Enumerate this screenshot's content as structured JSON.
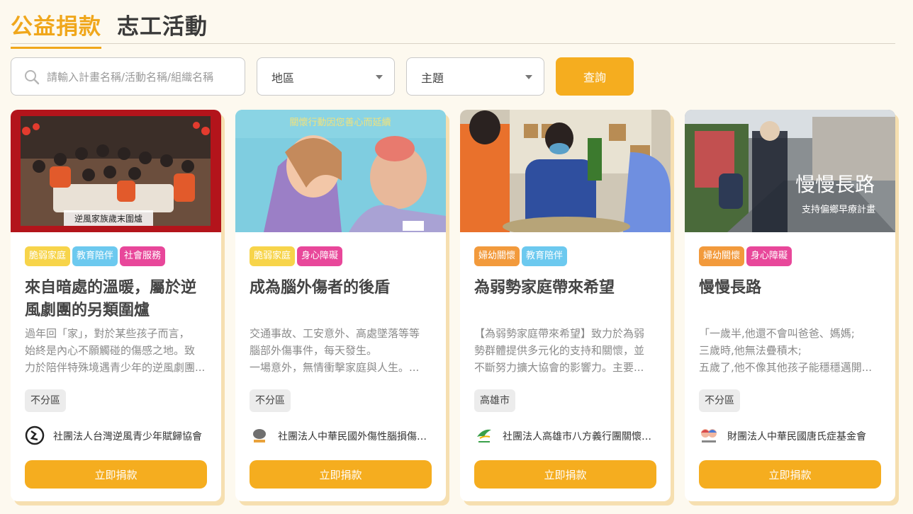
{
  "tabs": [
    {
      "label": "公益捐款",
      "active": true
    },
    {
      "label": "志工活動",
      "active": false
    }
  ],
  "filters": {
    "search_placeholder": "請輸入計畫名稱/活動名稱/組織名稱",
    "region_label": "地區",
    "topic_label": "主題",
    "search_button": "查詢"
  },
  "colors": {
    "accent": "#f5ad1f",
    "tag_yellow": "#f7d44a",
    "tag_blue": "#6cc9ef",
    "tag_pink": "#e8479a",
    "tag_orange": "#f29a3c"
  },
  "cards": [
    {
      "image_caption": "逆風家族歲末圍爐",
      "tags": [
        "脆弱家庭",
        "教育陪伴",
        "社會服務"
      ],
      "title": "來自暗處的溫暖，屬於逆風劇團的另類圍爐",
      "desc": [
        "過年回「家」，對於某些孩子而言，",
        "始終是內心不願觸碰的傷感之地。致",
        "力於陪伴特殊境遇青少年的逆風劇團..."
      ],
      "region": "不分區",
      "org": "社團法人台灣逆風青少年賦歸協會",
      "org_icon": "wind-logo-icon",
      "button": "立即捐款"
    },
    {
      "image_caption": "關懷行動因您善心而延續",
      "tags": [
        "脆弱家庭",
        "身心障礙"
      ],
      "title": "成為腦外傷者的後盾",
      "desc": [
        "交通事故、工安意外、高處墜落等等",
        "腦部外傷事件，每天發生。",
        "一場意外，無情衝擊家庭與人生。..."
      ],
      "region": "不分區",
      "org": "社團法人中華民國外傷性腦損傷協會",
      "org_icon": "brain-logo-icon",
      "button": "立即捐款"
    },
    {
      "image_caption": "",
      "tags": [
        "婦幼關懷",
        "教育陪伴"
      ],
      "title": "為弱勢家庭帶來希望",
      "desc": [
        "【為弱勢家庭帶來希望】致力於為弱",
        "勢群體提供多元化的支持和關懷，並",
        "不斷努力擴大協會的影響力。主要..."
      ],
      "region": "高雄市",
      "org": "社團法人高雄市八方義行團關懷協會",
      "org_icon": "bird-logo-icon",
      "button": "立即捐款"
    },
    {
      "image_caption": "慢慢長路",
      "image_subcaption": "支持偏鄉早療計畫",
      "tags": [
        "婦幼關懷",
        "身心障礙"
      ],
      "title": "慢慢長路",
      "desc": [
        "「一歲半,他還不會叫爸爸、媽媽;",
        "三歲時,他無法疊積木;",
        "五歲了,他不像其他孩子能穩穩邁開..."
      ],
      "region": "不分區",
      "org": "財團法人中華民國唐氏症基金會",
      "org_icon": "children-logo-icon",
      "button": "立即捐款"
    }
  ]
}
